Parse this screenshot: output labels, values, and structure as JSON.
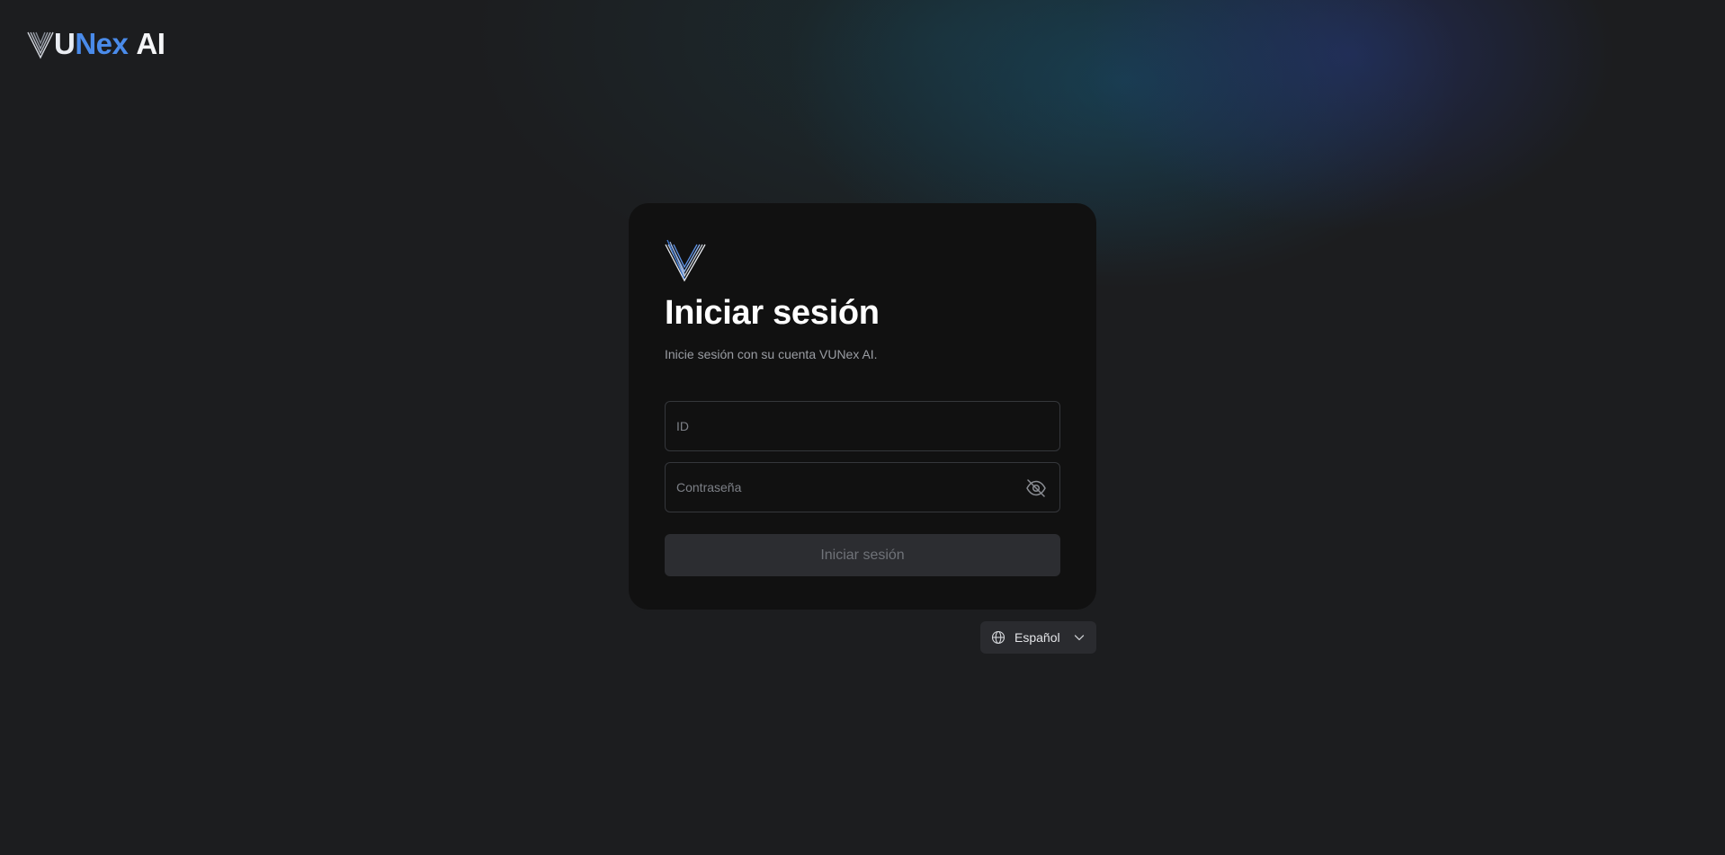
{
  "brand": {
    "part_u": "U",
    "part_nex": "Nex",
    "part_ai": "AI"
  },
  "login": {
    "title": "Iniciar sesión",
    "subtitle": "Inicie sesión con su cuenta VUNex AI.",
    "id_placeholder": "ID",
    "id_value": "",
    "password_placeholder": "Contraseña",
    "password_value": "",
    "submit_label": "Iniciar sesión"
  },
  "language": {
    "selected": "Español"
  },
  "icons": {
    "brand_logo": "v-stripes-logo-icon",
    "card_logo": "v-stripes-logo-icon",
    "password_toggle": "eye-off-icon",
    "language": "globe-icon",
    "dropdown": "chevron-down-icon"
  },
  "colors": {
    "background": "#1c1d1f",
    "card": "#111111",
    "brand_blue": "#4a8bea",
    "button_disabled": "#2c2d31"
  }
}
